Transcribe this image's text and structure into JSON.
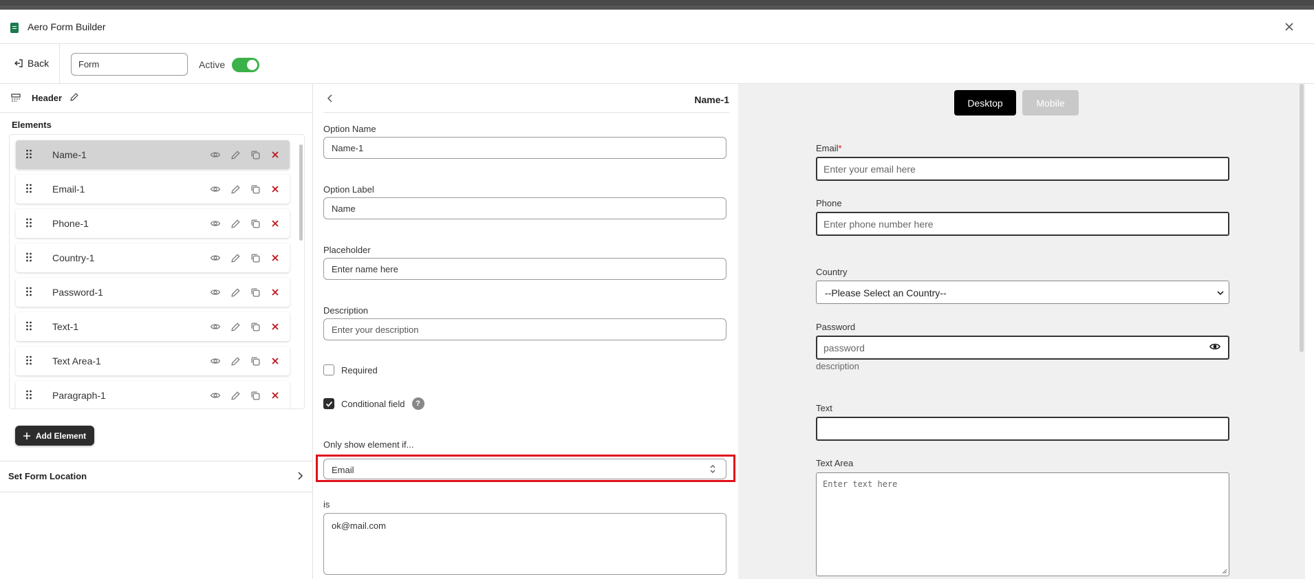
{
  "app": {
    "title": "Aero Form Builder"
  },
  "toolbar": {
    "back_label": "Back",
    "form_name": "Form",
    "active_label": "Active",
    "active": true
  },
  "left": {
    "header_label": "Header",
    "elements_title": "Elements",
    "elements": [
      {
        "label": "Name-1",
        "selected": true
      },
      {
        "label": "Email-1",
        "selected": false
      },
      {
        "label": "Phone-1",
        "selected": false
      },
      {
        "label": "Country-1",
        "selected": false
      },
      {
        "label": "Password-1",
        "selected": false
      },
      {
        "label": "Text-1",
        "selected": false
      },
      {
        "label": "Text Area-1",
        "selected": false
      },
      {
        "label": "Paragraph-1",
        "selected": false
      }
    ],
    "add_element_label": "Add Element",
    "set_location_label": "Set Form Location"
  },
  "editor": {
    "title": "Name-1",
    "option_name_label": "Option Name",
    "option_name_value": "Name-1",
    "option_label_label": "Option Label",
    "option_label_value": "Name",
    "placeholder_label": "Placeholder",
    "placeholder_value": "Enter name here",
    "description_label": "Description",
    "description_placeholder": "Enter your description",
    "required_label": "Required",
    "required_checked": false,
    "conditional_label": "Conditional field",
    "conditional_checked": true,
    "help_glyph": "?",
    "only_show_label": "Only show element if...",
    "condition_field": "Email",
    "is_label": "is",
    "is_value": "ok@mail.com"
  },
  "preview": {
    "desktop_label": "Desktop",
    "mobile_label": "Mobile",
    "email_label": "Email",
    "email_required_mark": "*",
    "email_placeholder": "Enter your email here",
    "phone_label": "Phone",
    "phone_placeholder": "Enter phone number here",
    "country_label": "Country",
    "country_value": "--Please Select an Country--",
    "password_label": "Password",
    "password_placeholder": "password",
    "password_description": "description",
    "text_label": "Text",
    "textarea_label": "Text Area",
    "textarea_placeholder": "Enter text here"
  },
  "colors": {
    "accent_green": "#3bb14a",
    "danger_red": "#e0101a",
    "delete_red": "#c0151b"
  },
  "icons": [
    "app-logo-icon",
    "close-icon",
    "back-icon",
    "header-layout-icon",
    "pencil-icon",
    "drag-handle-icon",
    "eye-icon",
    "copy-icon",
    "delete-x-icon",
    "plus-icon",
    "chevron-right-icon",
    "chevron-left-icon",
    "up-down-arrows-icon",
    "chevron-down-icon",
    "resize-grip-icon"
  ]
}
